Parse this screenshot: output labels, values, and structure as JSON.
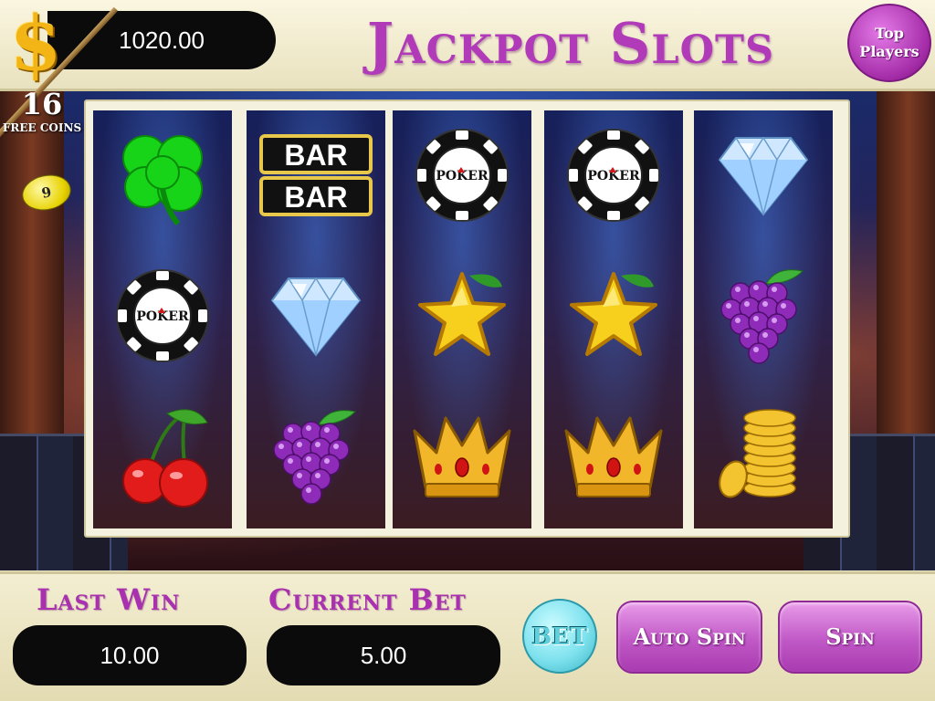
{
  "header": {
    "balance": "1020.00",
    "title": "Jackpot Slots",
    "top_players_line1": "Top",
    "top_players_line2": "Players"
  },
  "free_coins": {
    "count": "16",
    "label": "FREE COINS",
    "timer": "9"
  },
  "reels": [
    [
      "clover",
      "poker-chip",
      "cherries"
    ],
    [
      "bar-double",
      "diamond",
      "grapes"
    ],
    [
      "poker-chip",
      "star",
      "crown"
    ],
    [
      "poker-chip",
      "star",
      "crown"
    ],
    [
      "diamond",
      "grapes",
      "gold-coins"
    ]
  ],
  "chip_text": "POKER",
  "bar_text": "BAR",
  "footer": {
    "last_win_label": "Last Win",
    "last_win_value": "10.00",
    "current_bet_label": "Current Bet",
    "current_bet_value": "5.00",
    "bet_button": "BET",
    "auto_spin_button": "Auto Spin",
    "spin_button": "Spin"
  },
  "colors": {
    "accent_purple": "#b03ab8",
    "panel_cream": "#efeacc",
    "bet_cyan": "#7fe2ee"
  }
}
